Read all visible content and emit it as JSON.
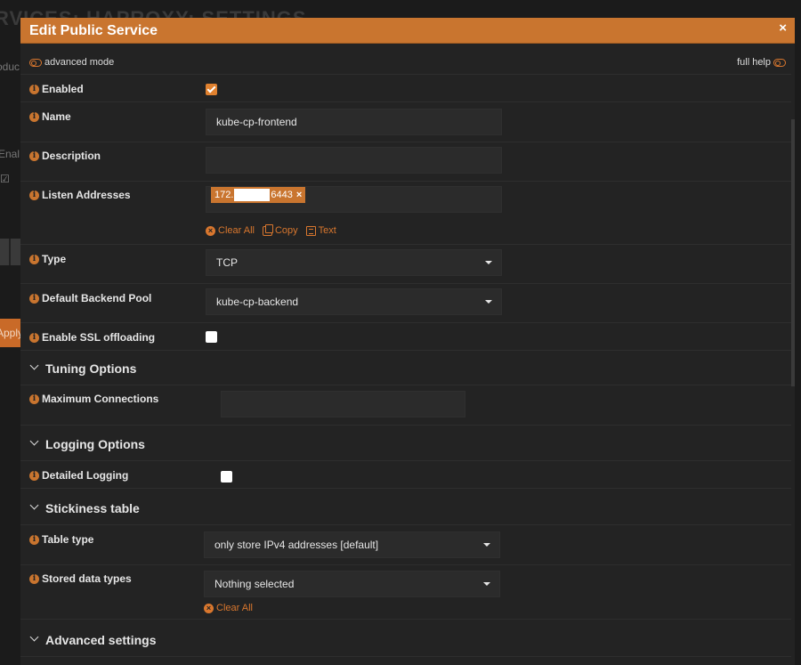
{
  "background": {
    "title": "RVICES: HAPROXY: SETTINGS",
    "subtitle": "oduc",
    "enabled_label": "Enal",
    "apply_label": "Apply"
  },
  "modal": {
    "title": "Edit Public Service",
    "close": "×",
    "advanced_mode": "advanced mode",
    "full_help": "full help"
  },
  "fields": {
    "enabled": {
      "label": "Enabled",
      "checked": true
    },
    "name": {
      "label": "Name",
      "value": "kube-cp-frontend"
    },
    "description": {
      "label": "Description",
      "value": ""
    },
    "listen_addresses": {
      "label": "Listen Addresses",
      "tag_prefix": "172.",
      "tag_suffix": "6443",
      "tag_remove": "×",
      "clear_all": "Clear All",
      "copy": "Copy",
      "text": "Text"
    },
    "type": {
      "label": "Type",
      "value": "TCP"
    },
    "default_backend_pool": {
      "label": "Default Backend Pool",
      "value": "kube-cp-backend"
    },
    "ssl_offloading": {
      "label": "Enable SSL offloading",
      "checked": false
    }
  },
  "sections": {
    "tuning": {
      "title": "Tuning Options",
      "max_connections": {
        "label": "Maximum Connections",
        "value": ""
      }
    },
    "logging": {
      "title": "Logging Options",
      "detailed_logging": {
        "label": "Detailed Logging",
        "checked": false
      }
    },
    "stickiness": {
      "title": "Stickiness table",
      "table_type": {
        "label": "Table type",
        "value": "only store IPv4 addresses [default]"
      },
      "stored_data_types": {
        "label": "Stored data types",
        "value": "Nothing selected",
        "clear_all": "Clear All"
      }
    },
    "advanced": {
      "title": "Advanced settings"
    }
  },
  "icons": {
    "info": "info-circle-icon",
    "toggle": "toggle-off-icon",
    "caret": "caret-down-icon",
    "clear": "times-circle-icon",
    "copy": "copy-icon",
    "text": "file-text-icon",
    "chevron": "chevron-down-icon"
  },
  "colors": {
    "accent": "#c9752f",
    "background": "#232323",
    "field": "#2b2b2b"
  }
}
